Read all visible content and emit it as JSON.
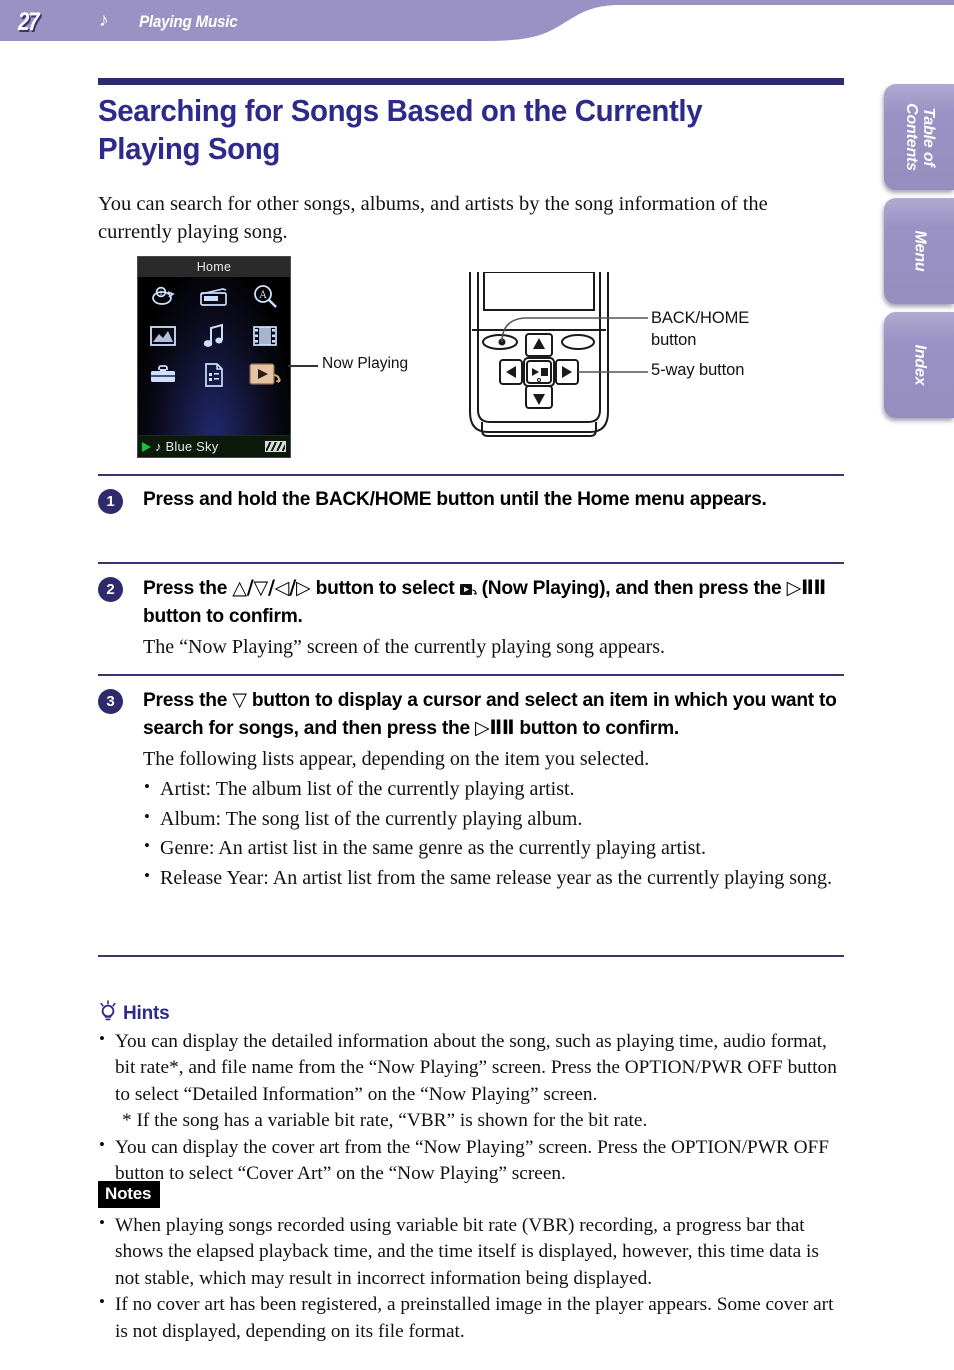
{
  "header": {
    "page_number": "27",
    "music_icon": "music-note-icon",
    "section_title": "Playing Music",
    "bg_color": "#9a92c4"
  },
  "side_tabs": [
    {
      "label": "Table of\nContents",
      "name": "table-of-contents"
    },
    {
      "label": "Menu",
      "name": "menu"
    },
    {
      "label": "Index",
      "name": "index"
    }
  ],
  "page": {
    "title": "Searching for Songs Based on the Currently Playing Song",
    "title_color": "#2e2a8c",
    "intro": "You can search for other songs, albums, and artists by the song information of the currently playing song."
  },
  "figure": {
    "device_screen": {
      "title_bar": "Home",
      "icons": [
        "podcast-icon",
        "fm-radio-icon",
        "search-icon",
        "photo-icon",
        "music-icon",
        "video-icon",
        "settings-toolbox-icon",
        "playlist-icon",
        "now-playing-icon"
      ],
      "selected_label": "Now Playing",
      "status_bar": {
        "play_icon": "play-icon",
        "note_icon": "music-note-icon",
        "song": "Blue Sky",
        "battery": "battery-full-icon"
      }
    },
    "callout_now_playing": "Now Playing",
    "callout_back_home": "BACK/HOME button",
    "callout_5way": "5-way button"
  },
  "steps": [
    {
      "number": "1",
      "head": "Press and hold the BACK/HOME button until the Home menu appears.",
      "sub": "",
      "bullets": []
    },
    {
      "number": "2",
      "head_parts": {
        "a": "Press the ",
        "dirs": "△/▽/◁/▷",
        "b": " button to select ",
        "np": "▶",
        "np2": "↩",
        "c": " (Now Playing), and then press the ",
        "play": "▷ⅡⅡ",
        "d": " button to confirm."
      },
      "sub": "The “Now Playing” screen of the currently playing song appears.",
      "bullets": []
    },
    {
      "number": "3",
      "head_parts": {
        "a": "Press the ",
        "dirs": "▽",
        "b": " button to display a cursor and select an item in which you want to search for songs, and then press the ",
        "play": "▷ⅡⅡ",
        "d": " button to confirm."
      },
      "sub": "The following lists appear, depending on the item you selected.",
      "bullets": [
        "Artist: The album list of the currently playing artist.",
        "Album: The song list of the currently playing album.",
        "Genre: An artist list in the same genre as the currently playing artist.",
        "Release Year: An artist list from the same release year as the currently playing song."
      ]
    }
  ],
  "hints": {
    "title": "Hints",
    "icon": "lightbulb-icon",
    "items": [
      "You can display the detailed information about the song, such as playing time, audio format, bit rate*, and file name from the “Now Playing” screen. Press the OPTION/PWR OFF button to select “Detailed Information” on the “Now Playing” screen.",
      "* If the song has a variable bit rate, “VBR” is shown for the bit rate.",
      "You can display the cover art from the “Now Playing” screen. Press the OPTION/PWR OFF button to select “Cover Art” on the “Now Playing” screen."
    ]
  },
  "notes": {
    "title": "Notes",
    "items": [
      "When playing songs recorded using variable bit rate (VBR) recording, a progress bar that shows the elapsed playback time, and the time itself is displayed, however, this time data is not stable, which may result in incorrect information being displayed.",
      "If no cover art has been registered, a preinstalled image in the player appears. Some cover art is not displayed, depending on its file format."
    ]
  }
}
